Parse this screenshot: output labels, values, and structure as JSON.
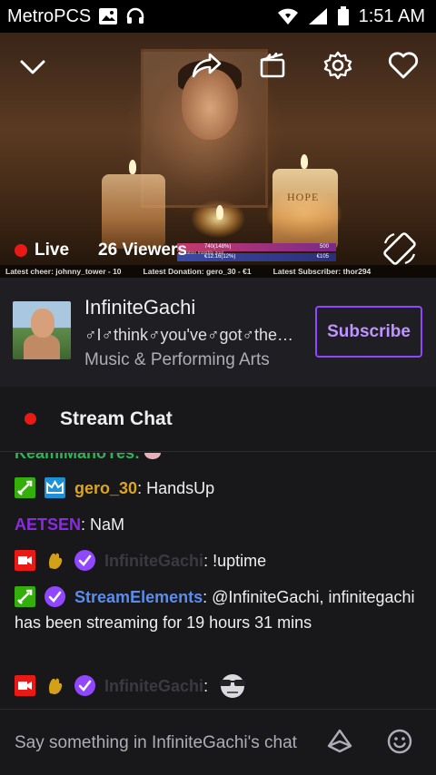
{
  "status_bar": {
    "carrier": "MetroPCS",
    "time": "1:51 AM"
  },
  "player": {
    "live_label": "Live",
    "viewers": "26 Viewers",
    "overlay": {
      "bar1_left": "740(148%)",
      "bar1_right": "500",
      "bar2_left": "€12.16(12%)",
      "bar2_right": "€105",
      "bar_caption": "donation monthly goal"
    },
    "ticker": {
      "latest_cheer": "Latest cheer: johnny_tower - 10",
      "latest_donation": "Latest Donation: gero_30 - €1",
      "latest_subscriber": "Latest Subscriber: thor294"
    },
    "candle_text": "HOPE"
  },
  "channel": {
    "name": "InfiniteGachi",
    "title": "♂I♂think♂you've♂got♂the♂wrong♂door",
    "category": "Music & Performing Arts",
    "subscribe_label": "Subscribe"
  },
  "chat_header": {
    "title": "Stream Chat"
  },
  "chat": {
    "partial_top": "KeamiMahoYes:",
    "messages": [
      {
        "user": "gero_30",
        "user_color": "#daa520",
        "sep": ": ",
        "text": "HandsUp",
        "badges": [
          "mod",
          "sub"
        ]
      },
      {
        "user": "AETSEN",
        "user_color": "#8a2be2",
        "sep": ": ",
        "text": "NaM",
        "badges": []
      },
      {
        "user": "InfiniteGachi",
        "user_color": "#3a3a40",
        "sep": ": ",
        "text": "!uptime",
        "badges": [
          "broadcaster",
          "gold",
          "verified"
        ]
      },
      {
        "user": "StreamElements",
        "user_color": "#5b8def",
        "sep": ": ",
        "text": "@InfiniteGachi, infinitegachi has been streaming for 19 hours 31 mins",
        "badges": [
          "mod",
          "verified"
        ]
      },
      {
        "user": "InfiniteGachi",
        "user_color": "#3a3a40",
        "sep": ": ",
        "text": "",
        "badges": [
          "broadcaster",
          "gold",
          "verified"
        ],
        "emote": "sunglasses-emote"
      }
    ]
  },
  "composer": {
    "placeholder": "Say something in InfiniteGachi's chat"
  },
  "colors": {
    "accent": "#9147ff",
    "live_red": "#e91916",
    "background": "#18181b"
  }
}
